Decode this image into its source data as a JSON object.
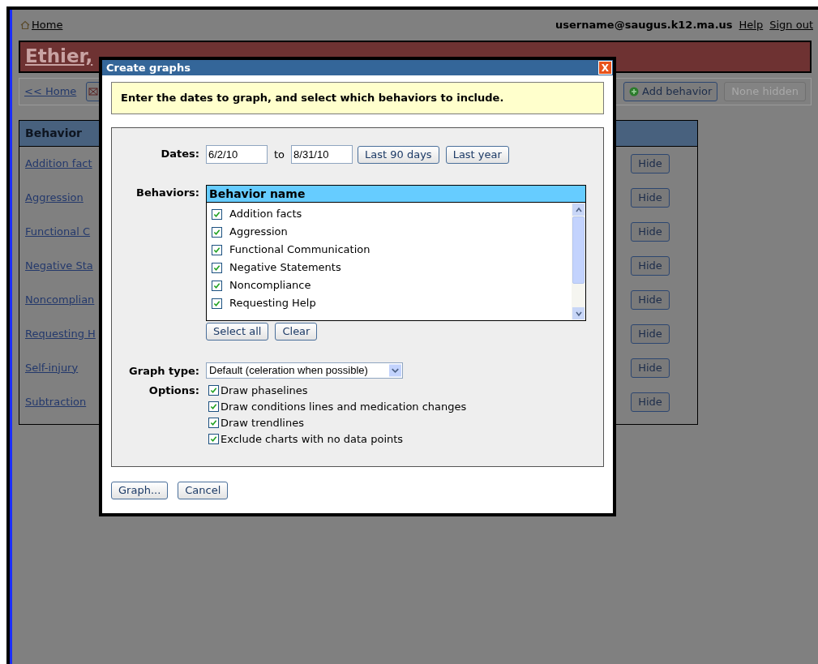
{
  "header": {
    "home_link": "Home",
    "username": "username@saugus.k12.ma.us",
    "help_link": "Help",
    "signout_link": "Sign out"
  },
  "student_name": "Ethier,",
  "toolbar": {
    "back_link": "<< Home",
    "add_button": "Add behavior",
    "hidden_button": {
      "label": "None hidden",
      "disabled": true
    }
  },
  "behavior_table": {
    "column_1": "Behavior",
    "rows": [
      {
        "name": "Addition fact",
        "action": "Hide"
      },
      {
        "name": "Aggression",
        "action": "Hide"
      },
      {
        "name": "Functional C",
        "action": "Hide"
      },
      {
        "name": "Negative Sta",
        "action": "Hide"
      },
      {
        "name": "Noncomplian",
        "action": "Hide"
      },
      {
        "name": "Requesting H",
        "action": "Hide"
      },
      {
        "name": "Self-injury",
        "action": "Hide"
      },
      {
        "name": "Subtraction",
        "action": "Hide"
      }
    ]
  },
  "dialog": {
    "title": "Create graphs",
    "close": "X",
    "instructions": "Enter the dates to graph, and select which behaviors to include.",
    "dates": {
      "label": "Dates:",
      "from": "6/2/10",
      "separator": "to",
      "to": "8/31/10",
      "buttons": [
        "Last 90 days",
        "Last year"
      ]
    },
    "behaviors": {
      "label": "Behaviors:",
      "column": "Behavior name",
      "items": [
        {
          "name": "Addition facts",
          "checked": true
        },
        {
          "name": "Aggression",
          "checked": true
        },
        {
          "name": "Functional Communication",
          "checked": true
        },
        {
          "name": "Negative Statements",
          "checked": true
        },
        {
          "name": "Noncompliance",
          "checked": true
        },
        {
          "name": "Requesting Help",
          "checked": true
        }
      ],
      "buttons": [
        "Select all",
        "Clear"
      ]
    },
    "graph_type": {
      "label": "Graph type:",
      "value": "Default (celeration when possible)"
    },
    "options": {
      "label": "Options:",
      "items": [
        {
          "label": "Draw phaselines",
          "checked": true
        },
        {
          "label": "Draw conditions lines and medication changes",
          "checked": true
        },
        {
          "label": "Draw trendlines",
          "checked": true
        },
        {
          "label": "Exclude charts with no data points",
          "checked": true
        }
      ]
    },
    "buttons": [
      "Graph...",
      "Cancel"
    ]
  }
}
